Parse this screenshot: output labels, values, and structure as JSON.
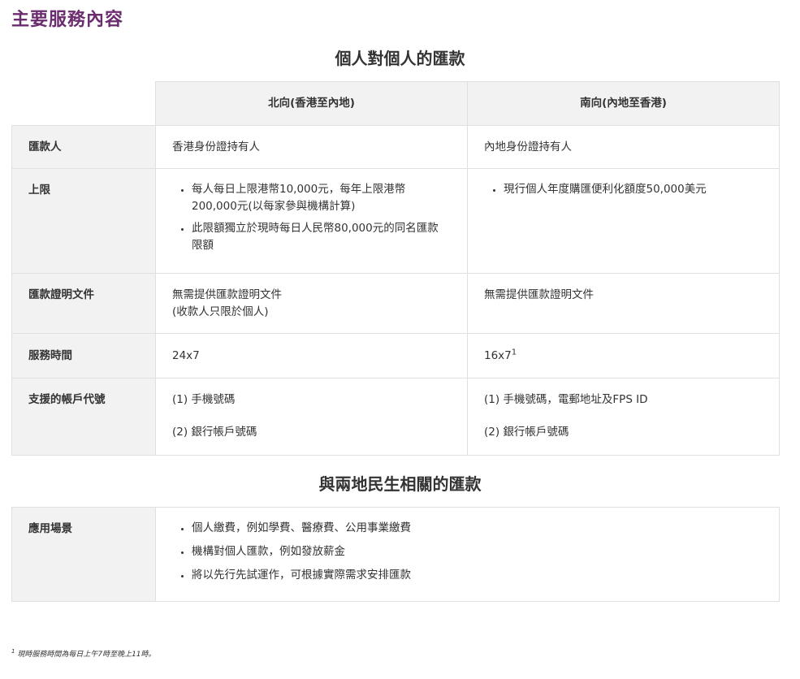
{
  "page_heading": "主要服務內容",
  "section1": {
    "title": "個人對個人的匯款",
    "col_north": "北向(香港至內地)",
    "col_south": "南向(內地至香港)",
    "rows": {
      "remitter": {
        "label": "匯款人",
        "north": "香港身份證持有人",
        "south": "內地身份證持有人"
      },
      "limit": {
        "label": "上限",
        "north_1a": "每人每日上限港幣10,000元，每年上限港幣",
        "north_1b": "200,000元(以每家參與機構計算)",
        "north_2a": "此限額獨立於現時每日人民幣80,000元的同名匯款",
        "north_2b": "限額",
        "south_1": "現行個人年度購匯便利化額度50,000美元"
      },
      "proof": {
        "label": "匯款證明文件",
        "north_a": "無需提供匯款證明文件",
        "north_b": "(收款人只限於個人)",
        "south": "無需提供匯款證明文件"
      },
      "hours": {
        "label": "服務時間",
        "north": "24x7",
        "south": "16x7",
        "south_sup": "1"
      },
      "proxy": {
        "label": "支援的帳戶代號",
        "north_1": "(1) 手機號碼",
        "north_2": "(2) 銀行帳戶號碼",
        "south_1": "(1) 手機號碼，電郵地址及FPS ID",
        "south_2": "(2) 銀行帳戶號碼"
      }
    }
  },
  "section2": {
    "title": "與兩地民生相關的匯款",
    "label": "應用場景",
    "items": [
      "個人繳費，例如學費、醫療費、公用事業繳費",
      "機構對個人匯款，例如發放薪金",
      "將以先行先試運作，可根據實際需求安排匯款"
    ]
  },
  "footnote": {
    "mark": "1",
    "text": "現時服務時間為每日上午7時至晚上11時。"
  }
}
